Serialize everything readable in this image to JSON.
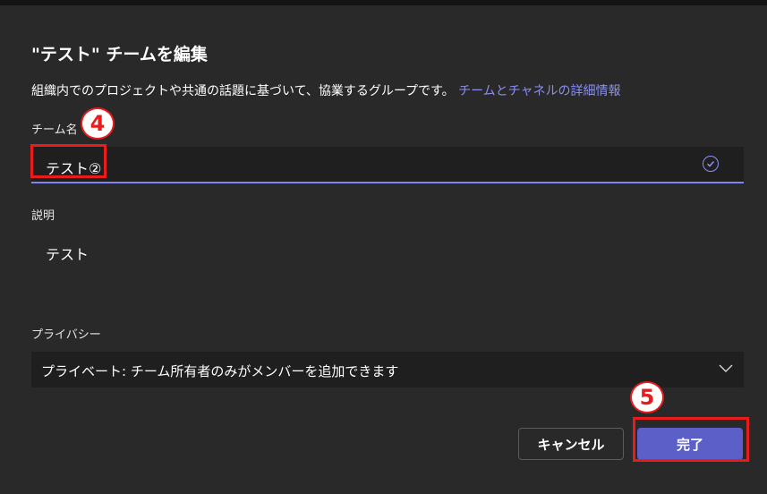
{
  "dialog": {
    "title": "\"テスト\" チームを編集",
    "subtitle": "組織内でのプロジェクトや共通の話題に基づいて、協業するグループです。",
    "subtitle_link": "チームとチャネルの詳細情報"
  },
  "team_name": {
    "label": "チーム名",
    "value": "テスト②",
    "icon": "check-circle-icon"
  },
  "description": {
    "label": "説明",
    "value": "テスト"
  },
  "privacy": {
    "label": "プライバシー",
    "selected": "プライベート: チーム所有者のみがメンバーを追加できます",
    "icon": "chevron-down-icon"
  },
  "buttons": {
    "cancel": "キャンセル",
    "done": "完了"
  },
  "annotations": {
    "step4": "4",
    "step5": "5",
    "highlight_color": "#e81c1c"
  },
  "colors": {
    "accent": "#5b5fc7",
    "link": "#8b8ff0",
    "background": "#292929"
  }
}
